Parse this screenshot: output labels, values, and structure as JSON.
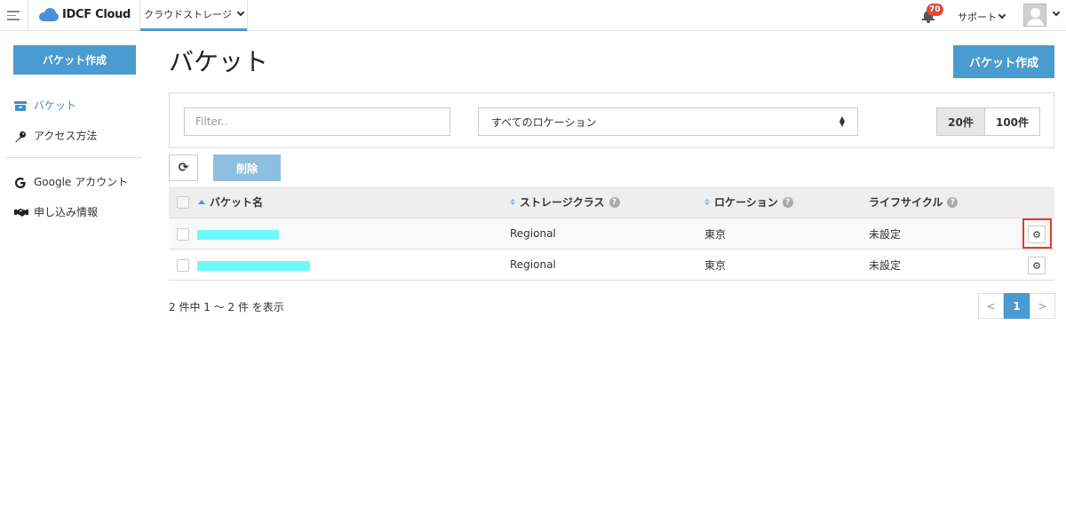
{
  "header": {
    "logo_text": "IDCF Cloud",
    "service_tab": "クラウドストレージ",
    "notification_count": "70",
    "support_label": "サポート"
  },
  "sidebar": {
    "create_button": "バケット作成",
    "items": [
      {
        "label": "バケット",
        "icon": "bucket-icon",
        "active": true
      },
      {
        "label": "アクセス方法",
        "icon": "key-icon",
        "active": false
      },
      {
        "label": "Google アカウント",
        "icon": "google-icon",
        "active": false
      },
      {
        "label": "申し込み情報",
        "icon": "handshake-icon",
        "active": false
      }
    ]
  },
  "main": {
    "title": "バケット",
    "create_button": "バケット作成",
    "filter_placeholder": "Filter..",
    "location_select": "すべてのロケーション",
    "page_sizes": [
      "20件",
      "100件"
    ],
    "selected_page_size": "20件",
    "delete_button": "削除",
    "table": {
      "columns": [
        "バケット名",
        "ストレージクラス",
        "ロケーション",
        "ライフサイクル"
      ],
      "rows": [
        {
          "name": "",
          "storage_class": "Regional",
          "location": "東京",
          "lifecycle": "未設定"
        },
        {
          "name": "",
          "storage_class": "Regional",
          "location": "東京",
          "lifecycle": "未設定"
        }
      ]
    },
    "summary": "2 件中 1 〜 2 件 を表示",
    "pagination": {
      "prev": "<",
      "current": "1",
      "next": ">"
    }
  },
  "colors": {
    "accent": "#4a9bcf",
    "badge": "#e34a3a",
    "highlight": "#e03a2f",
    "redaction": "#6ff8fb"
  }
}
